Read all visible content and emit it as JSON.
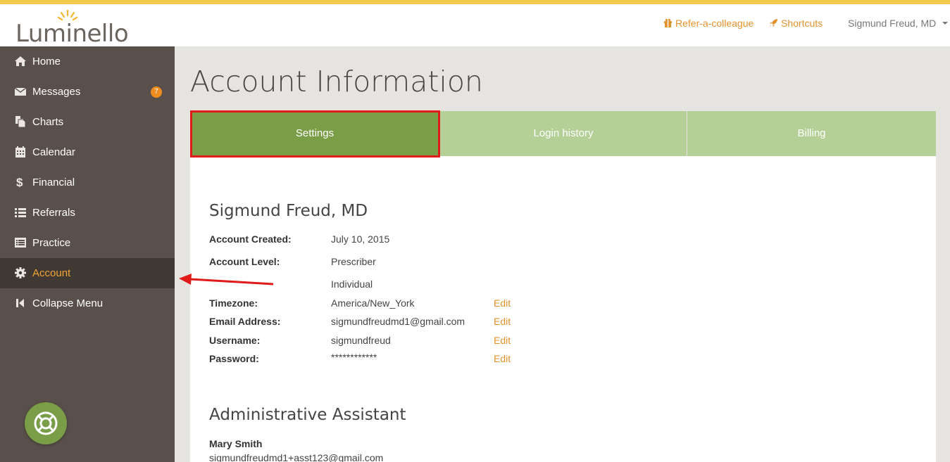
{
  "app": {
    "logo_text": "Luminello",
    "accent": "#f2c94c",
    "link_color": "#e2922e",
    "sidebar_bg": "#5a504b",
    "tab_active": "#7a9d48",
    "tab_inactive": "#b5d097"
  },
  "topnav": {
    "refer": {
      "label": "Refer-a-colleague",
      "icon": "gift-icon"
    },
    "shortcuts": {
      "label": "Shortcuts",
      "icon": "rocket-icon"
    },
    "user": {
      "label": "Sigmund Freud, MD",
      "icon": "caret-down-icon"
    }
  },
  "sidebar": {
    "items": [
      {
        "label": "Home",
        "icon": "home-icon"
      },
      {
        "label": "Messages",
        "icon": "envelope-icon",
        "badge": "7"
      },
      {
        "label": "Charts",
        "icon": "files-icon"
      },
      {
        "label": "Calendar",
        "icon": "calendar-icon"
      },
      {
        "label": "Financial",
        "icon": "dollar-icon"
      },
      {
        "label": "Referrals",
        "icon": "list-icon"
      },
      {
        "label": "Practice",
        "icon": "list-alt-icon"
      },
      {
        "label": "Account",
        "icon": "gear-icon",
        "active": true
      },
      {
        "label": "Collapse Menu",
        "icon": "step-backward-icon"
      }
    ],
    "help_icon": "lifebuoy-icon"
  },
  "page": {
    "title": "Account Information"
  },
  "tabs": [
    {
      "label": "Settings",
      "active": true
    },
    {
      "label": "Login history",
      "active": false
    },
    {
      "label": "Billing",
      "active": false
    }
  ],
  "account": {
    "name": "Sigmund Freud, MD",
    "rows": [
      {
        "label": "Account Created:",
        "value": "July 10, 2015"
      },
      {
        "label": "Account Level:",
        "value": "Prescriber"
      },
      {
        "label": "",
        "value": "Individual"
      },
      {
        "label": "Timezone:",
        "value": "America/New_York",
        "edit": "Edit"
      },
      {
        "label": "Email Address:",
        "value": "sigmundfreudmd1@gmail.com",
        "edit": "Edit"
      },
      {
        "label": "Username:",
        "value": "sigmundfreud",
        "edit": "Edit"
      },
      {
        "label": "Password:",
        "value": "************",
        "edit": "Edit"
      }
    ]
  },
  "assistant": {
    "title": "Administrative Assistant",
    "name": "Mary Smith",
    "email": "sigmundfreudmd1+asst123@gmail.com"
  },
  "annotation": {
    "highlight_color": "#e01919"
  }
}
